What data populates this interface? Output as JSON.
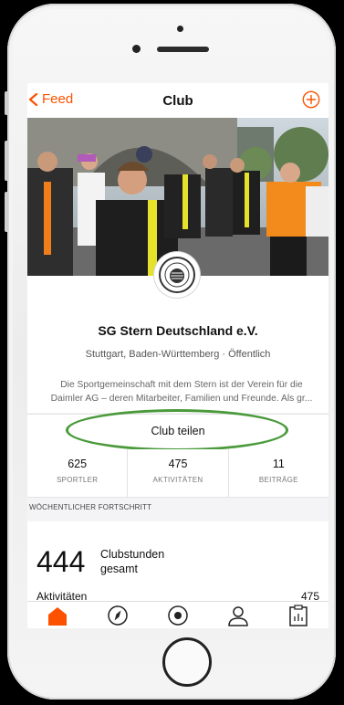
{
  "nav": {
    "back_label": "Feed",
    "title": "Club"
  },
  "club": {
    "name": "SG Stern Deutschland e.V.",
    "location": "Stuttgart, Baden-Württemberg · Öffentlich",
    "description": "Die Sportgemeinschaft mit dem Stern ist der Verein für die Daimler AG – deren Mitarbeiter, Familien und Freunde. Als gr...",
    "logo_text": "SG Stern"
  },
  "share": {
    "label": "Club teilen"
  },
  "stats": [
    {
      "value": "625",
      "label": "SPORTLER"
    },
    {
      "value": "475",
      "label": "AKTIVITÄTEN"
    },
    {
      "value": "11",
      "label": "BEITRÄGE"
    }
  ],
  "weekly": {
    "header": "WÖCHENTLICHER FORTSCHRITT",
    "hours_value": "444",
    "hours_label_line1": "Clubstunden",
    "hours_label_line2": "gesamt",
    "activities_label": "Aktivitäten",
    "activities_value": "475"
  },
  "tabs": [
    {
      "name": "home",
      "icon": "home-icon",
      "active": true
    },
    {
      "name": "explore",
      "icon": "compass-icon",
      "active": false
    },
    {
      "name": "record",
      "icon": "record-icon",
      "active": false
    },
    {
      "name": "profile",
      "icon": "profile-icon",
      "active": false
    },
    {
      "name": "training",
      "icon": "clipboard-icon",
      "active": false
    }
  ],
  "colors": {
    "accent": "#fc5200",
    "highlight": "#4a9a3b"
  }
}
